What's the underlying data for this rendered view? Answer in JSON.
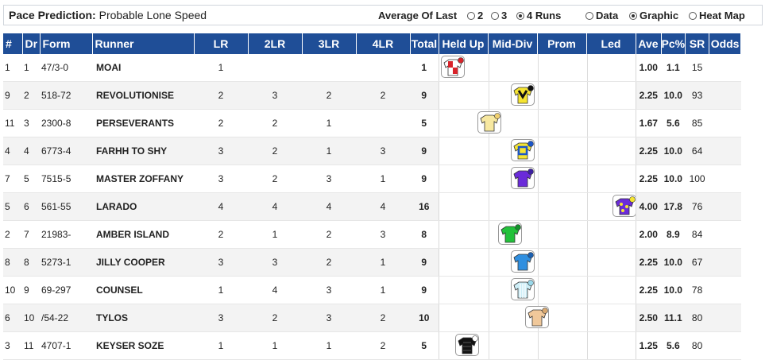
{
  "header": {
    "label": "Pace Prediction",
    "value": "Probable Lone Speed",
    "average_label": "Average Of Last",
    "runs_options": [
      "2",
      "3",
      "4 Runs"
    ],
    "runs_selected": 2,
    "view_options": [
      "Data",
      "Graphic",
      "Heat Map"
    ],
    "view_selected": 1
  },
  "columns": [
    "#",
    "Dr",
    "Form",
    "Runner",
    "LR",
    "2LR",
    "3LR",
    "4LR",
    "Total",
    "Held Up",
    "Mid-Div",
    "Prom",
    "Led",
    "Ave",
    "Pc%",
    "SR",
    "Odds"
  ],
  "rows": [
    {
      "num": "1",
      "dr": "1",
      "form": "47/3-0",
      "runner": "MOAI",
      "lr": "1",
      "lr2": "",
      "lr3": "",
      "lr4": "",
      "total": "1",
      "ave": "1.00",
      "pc": "1.1",
      "sr": "15",
      "odds": "",
      "silk": "red-white-check"
    },
    {
      "num": "9",
      "dr": "2",
      "form": "518-72",
      "runner": "REVOLUTIONISE",
      "lr": "2",
      "lr2": "3",
      "lr3": "2",
      "lr4": "2",
      "total": "9",
      "ave": "2.25",
      "pc": "10.0",
      "sr": "93",
      "odds": "",
      "silk": "yellow-black-chevron"
    },
    {
      "num": "11",
      "dr": "3",
      "form": "2300-8",
      "runner": "PERSEVERANTS",
      "lr": "2",
      "lr2": "2",
      "lr3": "1",
      "lr4": "",
      "total": "5",
      "ave": "1.67",
      "pc": "5.6",
      "sr": "85",
      "odds": "",
      "silk": "pale-yellow"
    },
    {
      "num": "4",
      "dr": "4",
      "form": "6773-4",
      "runner": "FARHH TO SHY",
      "lr": "3",
      "lr2": "2",
      "lr3": "1",
      "lr4": "3",
      "total": "9",
      "ave": "2.25",
      "pc": "10.0",
      "sr": "64",
      "odds": "",
      "silk": "yellow-blue-square"
    },
    {
      "num": "7",
      "dr": "5",
      "form": "7515-5",
      "runner": "MASTER ZOFFANY",
      "lr": "3",
      "lr2": "2",
      "lr3": "3",
      "lr4": "1",
      "total": "9",
      "ave": "2.25",
      "pc": "10.0",
      "sr": "100",
      "odds": "",
      "silk": "purple"
    },
    {
      "num": "5",
      "dr": "6",
      "form": "561-55",
      "runner": "LARADO",
      "lr": "4",
      "lr2": "4",
      "lr3": "4",
      "lr4": "4",
      "total": "16",
      "ave": "4.00",
      "pc": "17.8",
      "sr": "76",
      "odds": "",
      "silk": "purple-yellow-spots"
    },
    {
      "num": "2",
      "dr": "7",
      "form": "21983-",
      "runner": "AMBER ISLAND",
      "lr": "2",
      "lr2": "1",
      "lr3": "2",
      "lr4": "3",
      "total": "8",
      "ave": "2.00",
      "pc": "8.9",
      "sr": "84",
      "odds": "",
      "silk": "green"
    },
    {
      "num": "8",
      "dr": "8",
      "form": "5273-1",
      "runner": "JILLY COOPER",
      "lr": "3",
      "lr2": "3",
      "lr3": "2",
      "lr4": "1",
      "total": "9",
      "ave": "2.25",
      "pc": "10.0",
      "sr": "67",
      "odds": "",
      "silk": "blue"
    },
    {
      "num": "10",
      "dr": "9",
      "form": "69-297",
      "runner": "COUNSEL",
      "lr": "1",
      "lr2": "4",
      "lr3": "3",
      "lr4": "1",
      "total": "9",
      "ave": "2.25",
      "pc": "10.0",
      "sr": "78",
      "odds": "",
      "silk": "light-blue-stripe"
    },
    {
      "num": "6",
      "dr": "10",
      "form": "/54-22",
      "runner": "TYLOS",
      "lr": "3",
      "lr2": "2",
      "lr3": "3",
      "lr4": "2",
      "total": "10",
      "ave": "2.50",
      "pc": "11.1",
      "sr": "80",
      "odds": "",
      "silk": "beige"
    },
    {
      "num": "3",
      "dr": "11",
      "form": "4707-1",
      "runner": "KEYSER SOZE",
      "lr": "1",
      "lr2": "1",
      "lr3": "1",
      "lr4": "2",
      "total": "5",
      "ave": "1.25",
      "pc": "5.6",
      "sr": "80",
      "odds": "",
      "silk": "black-white"
    }
  ]
}
